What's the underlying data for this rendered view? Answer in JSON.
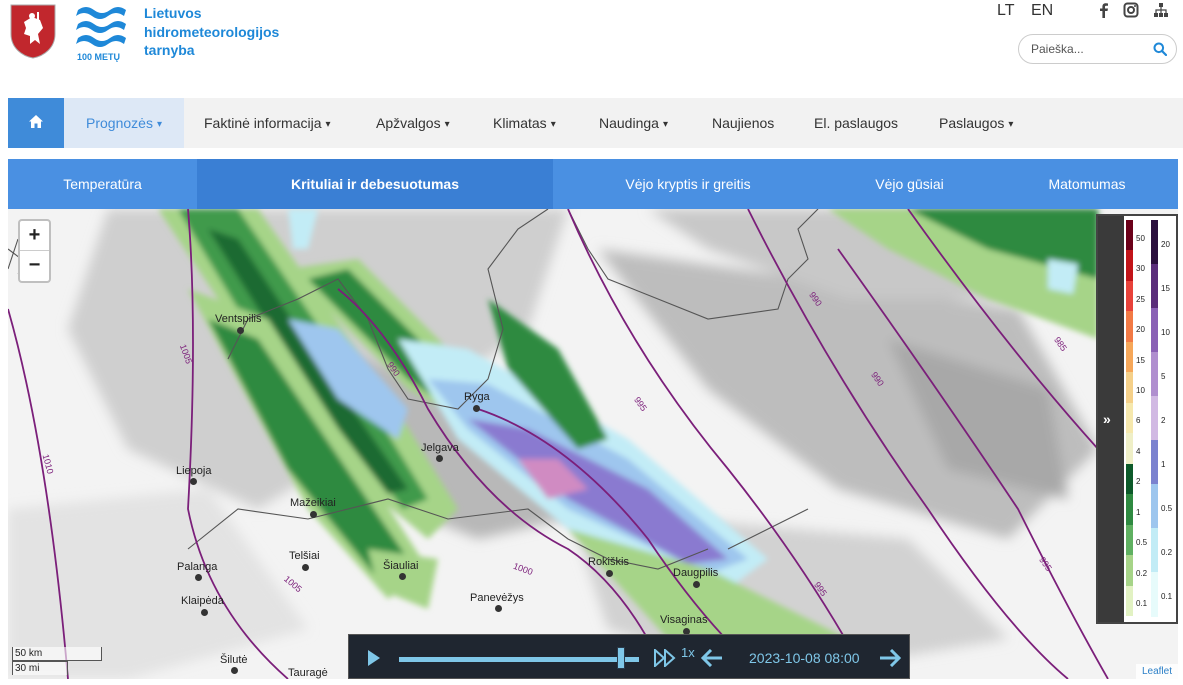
{
  "header": {
    "org_name_line1": "Lietuvos",
    "org_name_line2": "hidrometeorologijos",
    "org_name_line3": "tarnyba",
    "logo_caption": "100 METŲ",
    "lang_lt": "LT",
    "lang_en": "EN",
    "search_placeholder": "Paieška..."
  },
  "nav": {
    "items": [
      {
        "label": "Prognozės",
        "dropdown": true,
        "active": true
      },
      {
        "label": "Faktinė informacija",
        "dropdown": true
      },
      {
        "label": "Apžvalgos",
        "dropdown": true
      },
      {
        "label": "Klimatas",
        "dropdown": true
      },
      {
        "label": "Naudinga",
        "dropdown": true
      },
      {
        "label": "Naujienos",
        "dropdown": false
      },
      {
        "label": "El. paslaugos",
        "dropdown": false
      },
      {
        "label": "Paslaugos",
        "dropdown": true
      }
    ],
    "caret": "▾"
  },
  "subnav": {
    "items": [
      {
        "label": "Temperatūra"
      },
      {
        "label": "Krituliai ir debesuotumas",
        "active": true
      },
      {
        "label": "Vėjo kryptis ir greitis"
      },
      {
        "label": "Vėjo gūsiai"
      },
      {
        "label": "Matomumas"
      }
    ]
  },
  "map": {
    "zoom_in": "+",
    "zoom_out": "−",
    "cities": [
      "Ventspilis",
      "Ryga",
      "Jelgava",
      "Liepoja",
      "Mažeikiai",
      "Telšiai",
      "Šiauliai",
      "Palanga",
      "Klaipėda",
      "Panevėžys",
      "Rokiškis",
      "Daugpilis",
      "Visaginas",
      "Šilutė",
      "Tauragė"
    ],
    "isobars": [
      "1005",
      "1010",
      "1000",
      "1005",
      "995",
      "990",
      "995",
      "990",
      "985",
      "995",
      "990",
      "1000"
    ],
    "scale_km": "50 km",
    "scale_mi": "30 mi",
    "attribution": "Leaflet"
  },
  "legend": {
    "toggle": "»",
    "left_ticks": [
      "50",
      "30",
      "25",
      "20",
      "15",
      "10",
      "6",
      "4",
      "2",
      "1",
      "0.5",
      "0.2",
      "0.1"
    ],
    "right_ticks": [
      "20",
      "15",
      "10",
      "5",
      "2",
      "1",
      "0.5",
      "0.2",
      "0.1"
    ],
    "left_colors": [
      "#6b0019",
      "#c21419",
      "#e8423a",
      "#f27a45",
      "#f6a759",
      "#f5d089",
      "#f6e8ad",
      "#efefc7",
      "#0d5a2a",
      "#2f8a41",
      "#5fb061",
      "#a6d488",
      "#e2f2c3"
    ],
    "right_colors": [
      "#2a0f3d",
      "#5a2d7a",
      "#8a61b5",
      "#b08fcf",
      "#d1b9e3",
      "#7b82cf",
      "#9ec6ee",
      "#c2ecf6",
      "#e7fbfb"
    ]
  },
  "player": {
    "speed": "1x",
    "timestamp": "2023-10-08 08:00"
  },
  "colors": {
    "brand_blue": "#1e88d8",
    "nav_active_bg": "#dde8f6",
    "subnav_bg": "#4a90e2",
    "isobar": "#7b1f7a",
    "player_bg": "#1f2630",
    "player_accent": "#7fc7e8"
  }
}
